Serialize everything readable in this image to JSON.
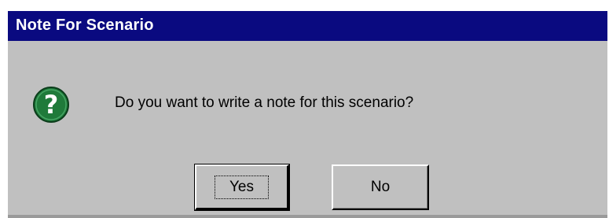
{
  "window": {
    "title": "Note For Scenario"
  },
  "dialog": {
    "icon": "question-icon",
    "message": "Do you want to write a note for this scenario?",
    "buttons": {
      "yes_label": "Yes",
      "no_label": "No"
    }
  },
  "colors": {
    "titlebar": "#0a0a80",
    "face": "#c0c0c0",
    "icon_fill": "#1f7a3a"
  }
}
